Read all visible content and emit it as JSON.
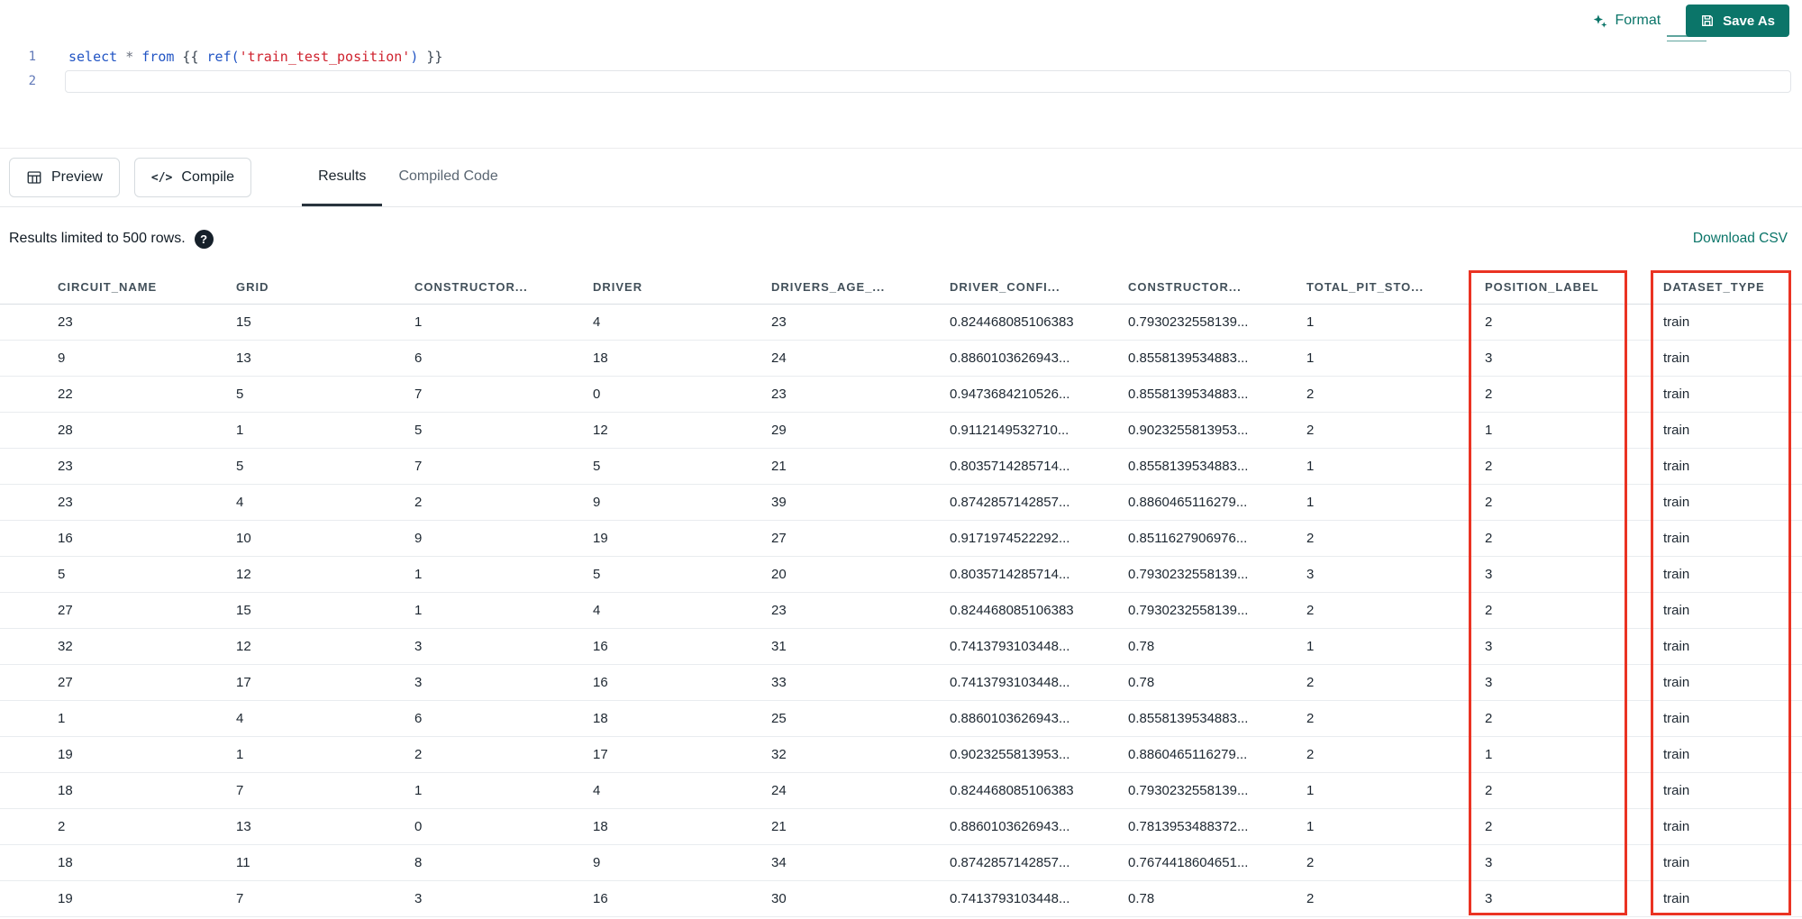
{
  "colors": {
    "accent": "#0b7569",
    "annotation": "#ea3323"
  },
  "header": {
    "format_label": "Format",
    "save_as_label": "Save As"
  },
  "editor": {
    "lines": [
      {
        "number": "1",
        "tokens": [
          {
            "text": "select",
            "type": "keyword"
          },
          {
            "text": " * ",
            "type": "operator"
          },
          {
            "text": "from",
            "type": "keyword"
          },
          {
            "text": " {{ ",
            "type": "plain"
          },
          {
            "text": "ref(",
            "type": "function"
          },
          {
            "text": "'train_test_position'",
            "type": "string"
          },
          {
            "text": ")",
            "type": "function"
          },
          {
            "text": " }}",
            "type": "plain"
          }
        ]
      },
      {
        "number": "2",
        "tokens": []
      }
    ]
  },
  "actions": {
    "preview_label": "Preview",
    "compile_label": "Compile"
  },
  "tabs": [
    {
      "label": "Results",
      "active": true
    },
    {
      "label": "Compiled Code",
      "active": false
    }
  ],
  "results_bar": {
    "limit_text": "Results limited to 500 rows.",
    "help_icon": "?",
    "download_label": "Download CSV"
  },
  "table": {
    "columns": [
      "CIRCUIT_NAME",
      "GRID",
      "CONSTRUCTOR...",
      "DRIVER",
      "DRIVERS_AGE_...",
      "DRIVER_CONFI...",
      "CONSTRUCTOR...",
      "TOTAL_PIT_STO...",
      "POSITION_LABEL",
      "DATASET_TYPE"
    ],
    "rows": [
      [
        "23",
        "15",
        "1",
        "4",
        "23",
        "0.824468085106383",
        "0.7930232558139...",
        "1",
        "2",
        "train"
      ],
      [
        "9",
        "13",
        "6",
        "18",
        "24",
        "0.8860103626943...",
        "0.8558139534883...",
        "1",
        "3",
        "train"
      ],
      [
        "22",
        "5",
        "7",
        "0",
        "23",
        "0.9473684210526...",
        "0.8558139534883...",
        "2",
        "2",
        "train"
      ],
      [
        "28",
        "1",
        "5",
        "12",
        "29",
        "0.9112149532710...",
        "0.9023255813953...",
        "2",
        "1",
        "train"
      ],
      [
        "23",
        "5",
        "7",
        "5",
        "21",
        "0.8035714285714...",
        "0.8558139534883...",
        "1",
        "2",
        "train"
      ],
      [
        "23",
        "4",
        "2",
        "9",
        "39",
        "0.8742857142857...",
        "0.8860465116279...",
        "1",
        "2",
        "train"
      ],
      [
        "16",
        "10",
        "9",
        "19",
        "27",
        "0.9171974522292...",
        "0.8511627906976...",
        "2",
        "2",
        "train"
      ],
      [
        "5",
        "12",
        "1",
        "5",
        "20",
        "0.8035714285714...",
        "0.7930232558139...",
        "3",
        "3",
        "train"
      ],
      [
        "27",
        "15",
        "1",
        "4",
        "23",
        "0.824468085106383",
        "0.7930232558139...",
        "2",
        "2",
        "train"
      ],
      [
        "32",
        "12",
        "3",
        "16",
        "31",
        "0.7413793103448...",
        "0.78",
        "1",
        "3",
        "train"
      ],
      [
        "27",
        "17",
        "3",
        "16",
        "33",
        "0.7413793103448...",
        "0.78",
        "2",
        "3",
        "train"
      ],
      [
        "1",
        "4",
        "6",
        "18",
        "25",
        "0.8860103626943...",
        "0.8558139534883...",
        "2",
        "2",
        "train"
      ],
      [
        "19",
        "1",
        "2",
        "17",
        "32",
        "0.9023255813953...",
        "0.8860465116279...",
        "2",
        "1",
        "train"
      ],
      [
        "18",
        "7",
        "1",
        "4",
        "24",
        "0.824468085106383",
        "0.7930232558139...",
        "1",
        "2",
        "train"
      ],
      [
        "2",
        "13",
        "0",
        "18",
        "21",
        "0.8860103626943...",
        "0.7813953488372...",
        "1",
        "2",
        "train"
      ],
      [
        "18",
        "11",
        "8",
        "9",
        "34",
        "0.8742857142857...",
        "0.7674418604651...",
        "2",
        "3",
        "train"
      ],
      [
        "19",
        "7",
        "3",
        "16",
        "30",
        "0.7413793103448...",
        "0.78",
        "2",
        "3",
        "train"
      ]
    ],
    "annotations": {
      "highlighted_columns": [
        "POSITION_LABEL",
        "DATASET_TYPE"
      ],
      "color": "#ea3323"
    }
  }
}
